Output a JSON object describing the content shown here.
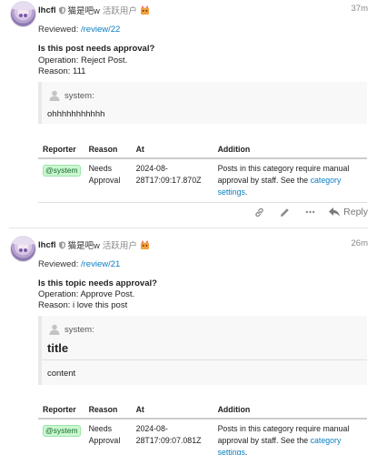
{
  "posts": [
    {
      "username": "lhcfl",
      "full_name": "猫是吧w",
      "user_title": "活跃用户",
      "age": "37m",
      "reviewed_prefix": "Reviewed:",
      "reviewed_link": "/review/22",
      "question": "Is this post needs approval?",
      "operation": "Operation: Reject Post.",
      "reason": "Reason: 111",
      "quote": {
        "author": "system:",
        "title": "",
        "text": "ohhhhhhhhhhh"
      },
      "table": {
        "headers": [
          "Reporter",
          "Reason",
          "At",
          "Addition"
        ],
        "row": {
          "reporter": "@system",
          "reason_line1": "Needs",
          "reason_line2": "Approval",
          "at_line1": "2024-08-",
          "at_line2": "28T17:09:17.870Z",
          "addition_line1": "Posts in this category require manual",
          "addition_line2_prefix": "approval by staff. See the",
          "addition_link": "category settings",
          "addition_suffix": "."
        }
      },
      "actions": {
        "reply_label": "Reply"
      }
    },
    {
      "username": "lhcfl",
      "full_name": "猫是吧w",
      "user_title": "活跃用户",
      "age": "26m",
      "reviewed_prefix": "Reviewed:",
      "reviewed_link": "/review/21",
      "question": "Is this topic needs approval?",
      "operation": "Operation: Approve Post.",
      "reason": "Reason: i love this post",
      "quote": {
        "author": "system:",
        "title": "title",
        "text": "content"
      },
      "table": {
        "headers": [
          "Reporter",
          "Reason",
          "At",
          "Addition"
        ],
        "row": {
          "reporter": "@system",
          "reason_line1": "Needs",
          "reason_line2": "Approval",
          "at_line1": "2024-08-",
          "at_line2": "28T17:09:07.081Z",
          "addition_line1": "Posts in this category require manual",
          "addition_line2_prefix": "approval by staff. See the",
          "addition_link": "category settings",
          "addition_suffix": "."
        }
      }
    }
  ],
  "icons": {
    "moderator": "shield-icon",
    "flair": "flair-icon",
    "quote_user": "user-icon",
    "link": "link-icon",
    "edit": "pencil-icon",
    "more": "ellipsis-icon",
    "reply": "reply-icon"
  },
  "colors": {
    "link": "#0a7ec2",
    "badge_bg": "#c9f7d0",
    "muted": "#888888"
  }
}
